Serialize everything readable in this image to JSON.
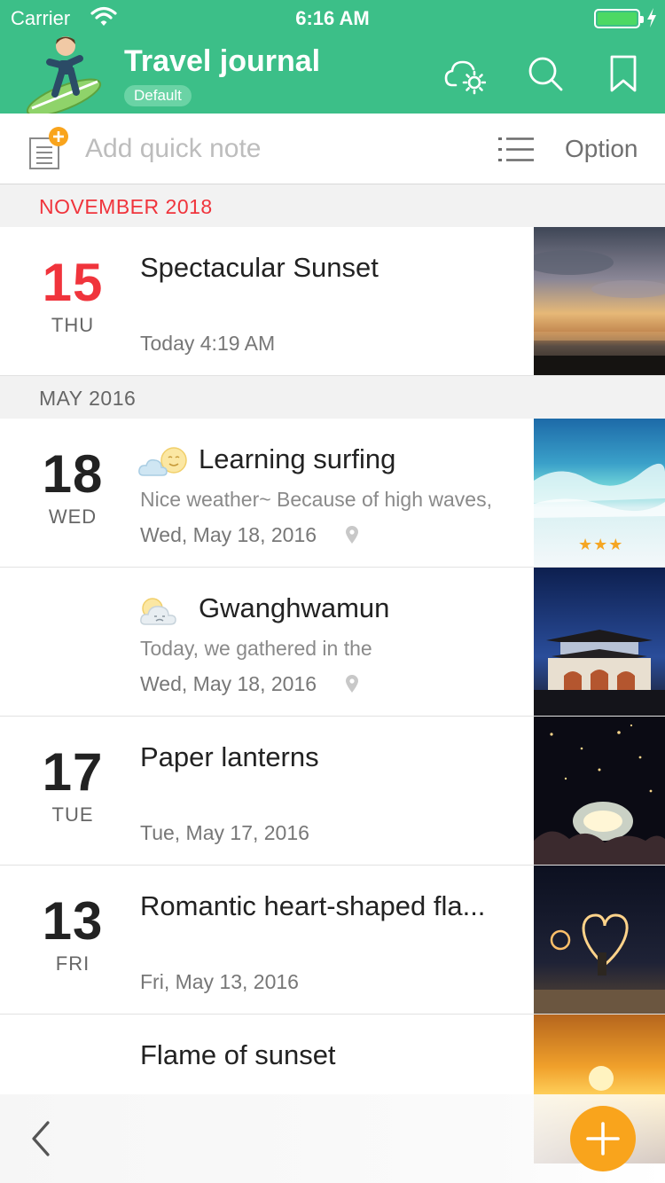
{
  "status_bar": {
    "carrier": "Carrier",
    "time": "6:16 AM"
  },
  "header": {
    "title": "Travel journal",
    "badge": "Default",
    "icons": [
      "cloud-settings-icon",
      "search-icon",
      "bookmark-icon"
    ],
    "background": "#3cbf88"
  },
  "quick_note": {
    "placeholder": "Add quick note",
    "option_label": "Option"
  },
  "sections": [
    {
      "label": "NOVEMBER 2018",
      "color": "#f0343c",
      "entries": [
        {
          "day": "15",
          "weekday": "THU",
          "title": "Spectacular Sunset",
          "meta": "Today 4:19 AM",
          "thumbnail": "sunset-beach-photo"
        }
      ]
    },
    {
      "label": "MAY 2016",
      "color": "#666666",
      "entries": [
        {
          "day": "18",
          "weekday": "WED",
          "title": "Learning surfing",
          "excerpt": "Nice weather~ Because of high waves,",
          "meta": "Wed, May 18, 2016",
          "weather": "sun-cloud-icon",
          "rating": "★★★",
          "thumbnail": "ocean-waves-photo"
        },
        {
          "day": "",
          "weekday": "",
          "title": "Gwanghwamun",
          "excerpt": "Today, we gathered in the",
          "meta": "Wed, May 18, 2016",
          "weather": "sun-cloud-face-icon",
          "thumbnail": "gwanghwamun-gate-photo"
        },
        {
          "day": "17",
          "weekday": "TUE",
          "title": "Paper lanterns",
          "meta": "Tue, May 17, 2016",
          "thumbnail": "lanterns-night-photo"
        },
        {
          "day": "13",
          "weekday": "FRI",
          "title": "Romantic heart-shaped fla...",
          "meta": "Fri, May 13, 2016",
          "thumbnail": "heart-sparkler-photo"
        },
        {
          "day": "",
          "weekday": "",
          "title": "Flame of sunset",
          "thumbnail": "orange-sunset-photo"
        }
      ]
    }
  ],
  "bottom_bar": {
    "back_icon": "chevron-left-icon",
    "add_icon": "plus-icon",
    "accent": "#f9a41c"
  }
}
